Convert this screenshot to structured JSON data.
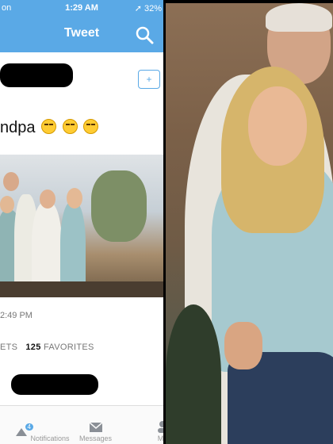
{
  "status_bar": {
    "carrier": "on",
    "time": "1:29 AM",
    "battery": "32%"
  },
  "nav": {
    "title": "Tweet"
  },
  "follow_label": "+",
  "tweet": {
    "text": "ndpa"
  },
  "meta": {
    "timestamp": "2:49 PM"
  },
  "stats": {
    "retweets_label": "ETS",
    "favorites_count": "125",
    "favorites_label": "FAVORITES"
  },
  "tabs": [
    {
      "label": "Notifications",
      "badge": "4"
    },
    {
      "label": "Messages"
    },
    {
      "label": "Me"
    }
  ],
  "colors": {
    "twitter_blue": "#5aa9e6"
  }
}
